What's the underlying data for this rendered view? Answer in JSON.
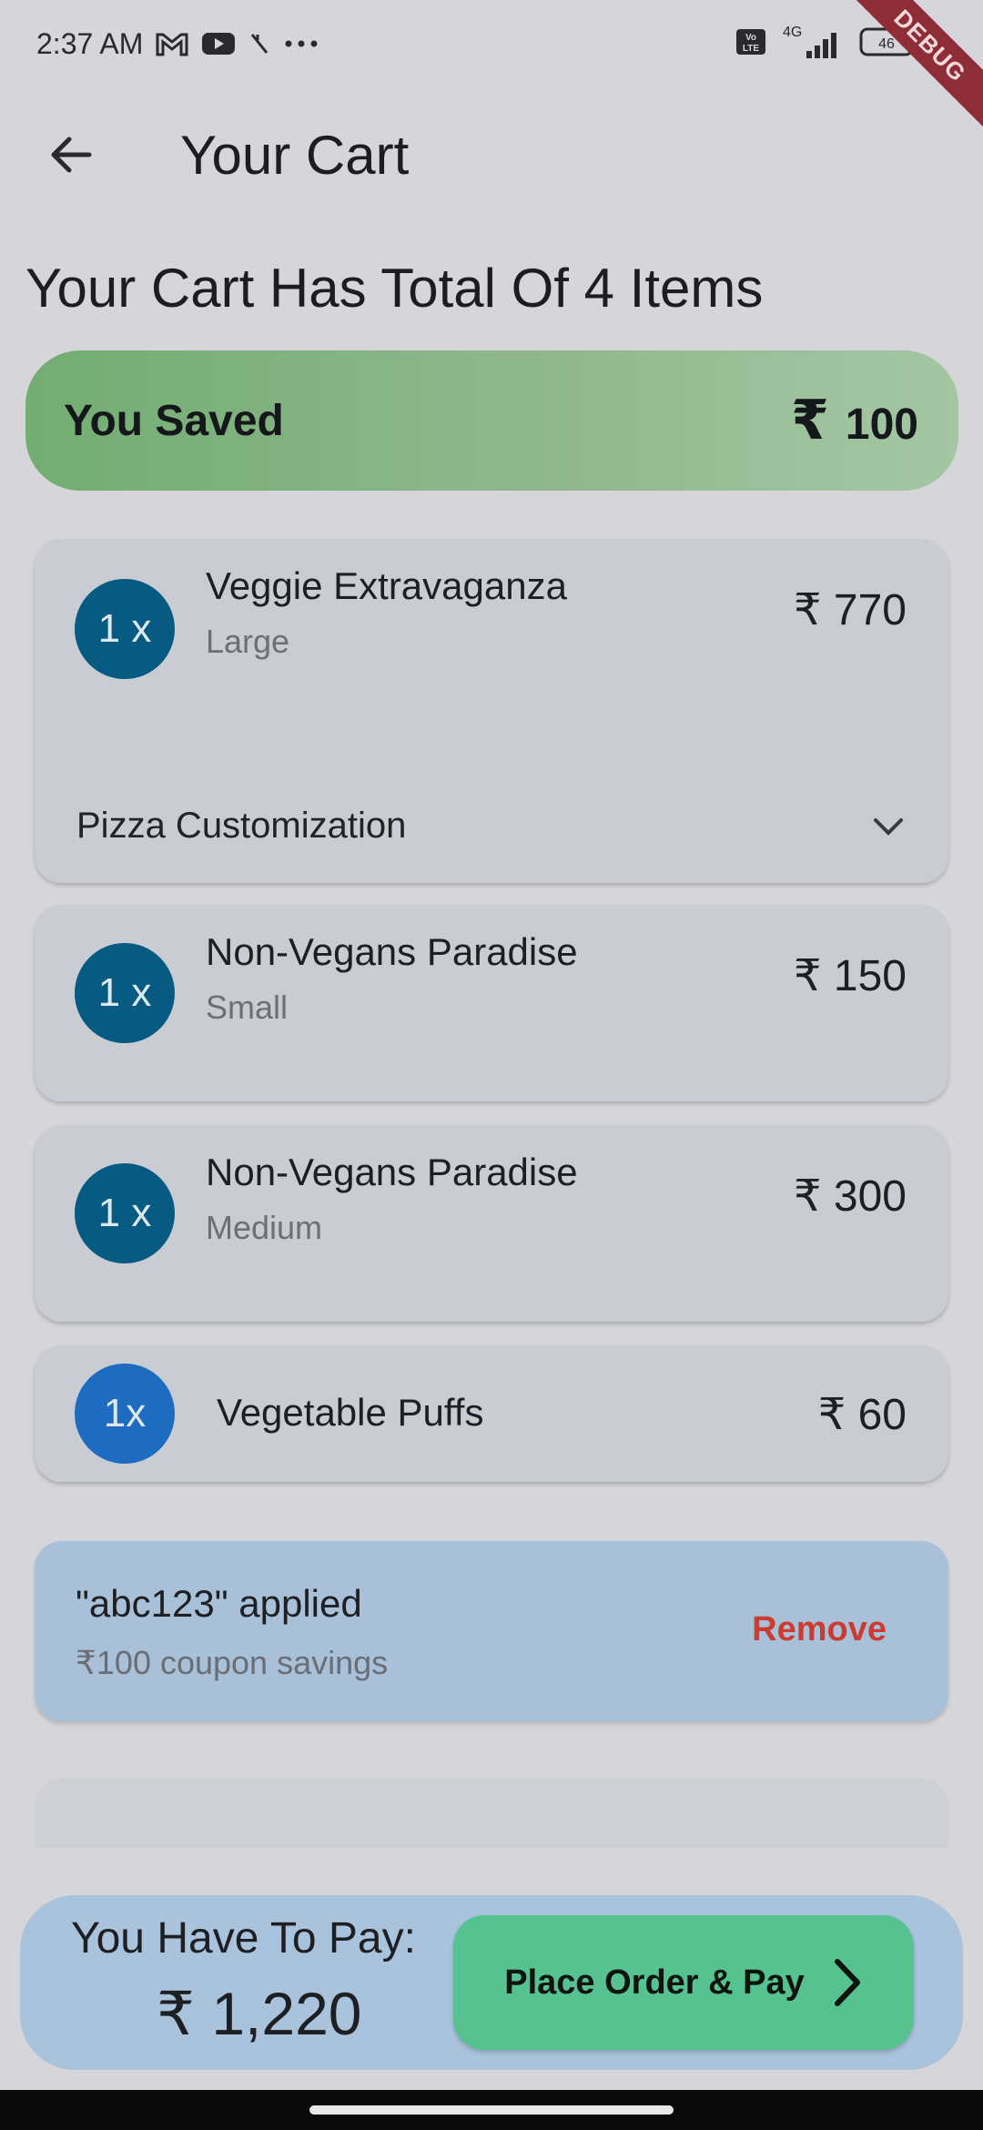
{
  "status_bar": {
    "time": "2:37 AM",
    "network": "4G",
    "volte": "Vo LTE",
    "icons": [
      "gmail-icon",
      "youtube-icon",
      "signal-off-icon",
      "more-dots-icon",
      "volte-icon",
      "cell-signal-icon",
      "battery-icon"
    ]
  },
  "debug_banner": "DEBUG",
  "app_bar": {
    "title": "Your Cart",
    "back_icon": "arrow-left-icon"
  },
  "cart_heading": "Your Cart Has Total Of 4 Items",
  "savings": {
    "label": "You Saved",
    "currency": "₹",
    "amount": "100"
  },
  "items": [
    {
      "qty": "1 x",
      "name": "Veggie Extravaganza",
      "size": "Large",
      "price": "₹ 770",
      "customization": "Pizza Customization"
    },
    {
      "qty": "1 x",
      "name": "Non-Vegans Paradise",
      "size": "Small",
      "price": "₹ 150"
    },
    {
      "qty": "1 x",
      "name": "Non-Vegans Paradise",
      "size": "Medium",
      "price": "₹ 300"
    },
    {
      "qty": "1x",
      "name": "Vegetable Puffs",
      "price": "₹ 60"
    }
  ],
  "coupon": {
    "code": "\"abc123\" applied",
    "savings": "₹100 coupon savings",
    "remove_label": "Remove"
  },
  "pay": {
    "label": "You Have To Pay:",
    "amount": "₹ 1,220",
    "button_label": "Place Order & Pay"
  },
  "colors": {
    "saved_green": "#73ad72",
    "badge_blue": "#075a82",
    "pay_button": "#55c28f",
    "remove_red": "#cc3b32"
  }
}
